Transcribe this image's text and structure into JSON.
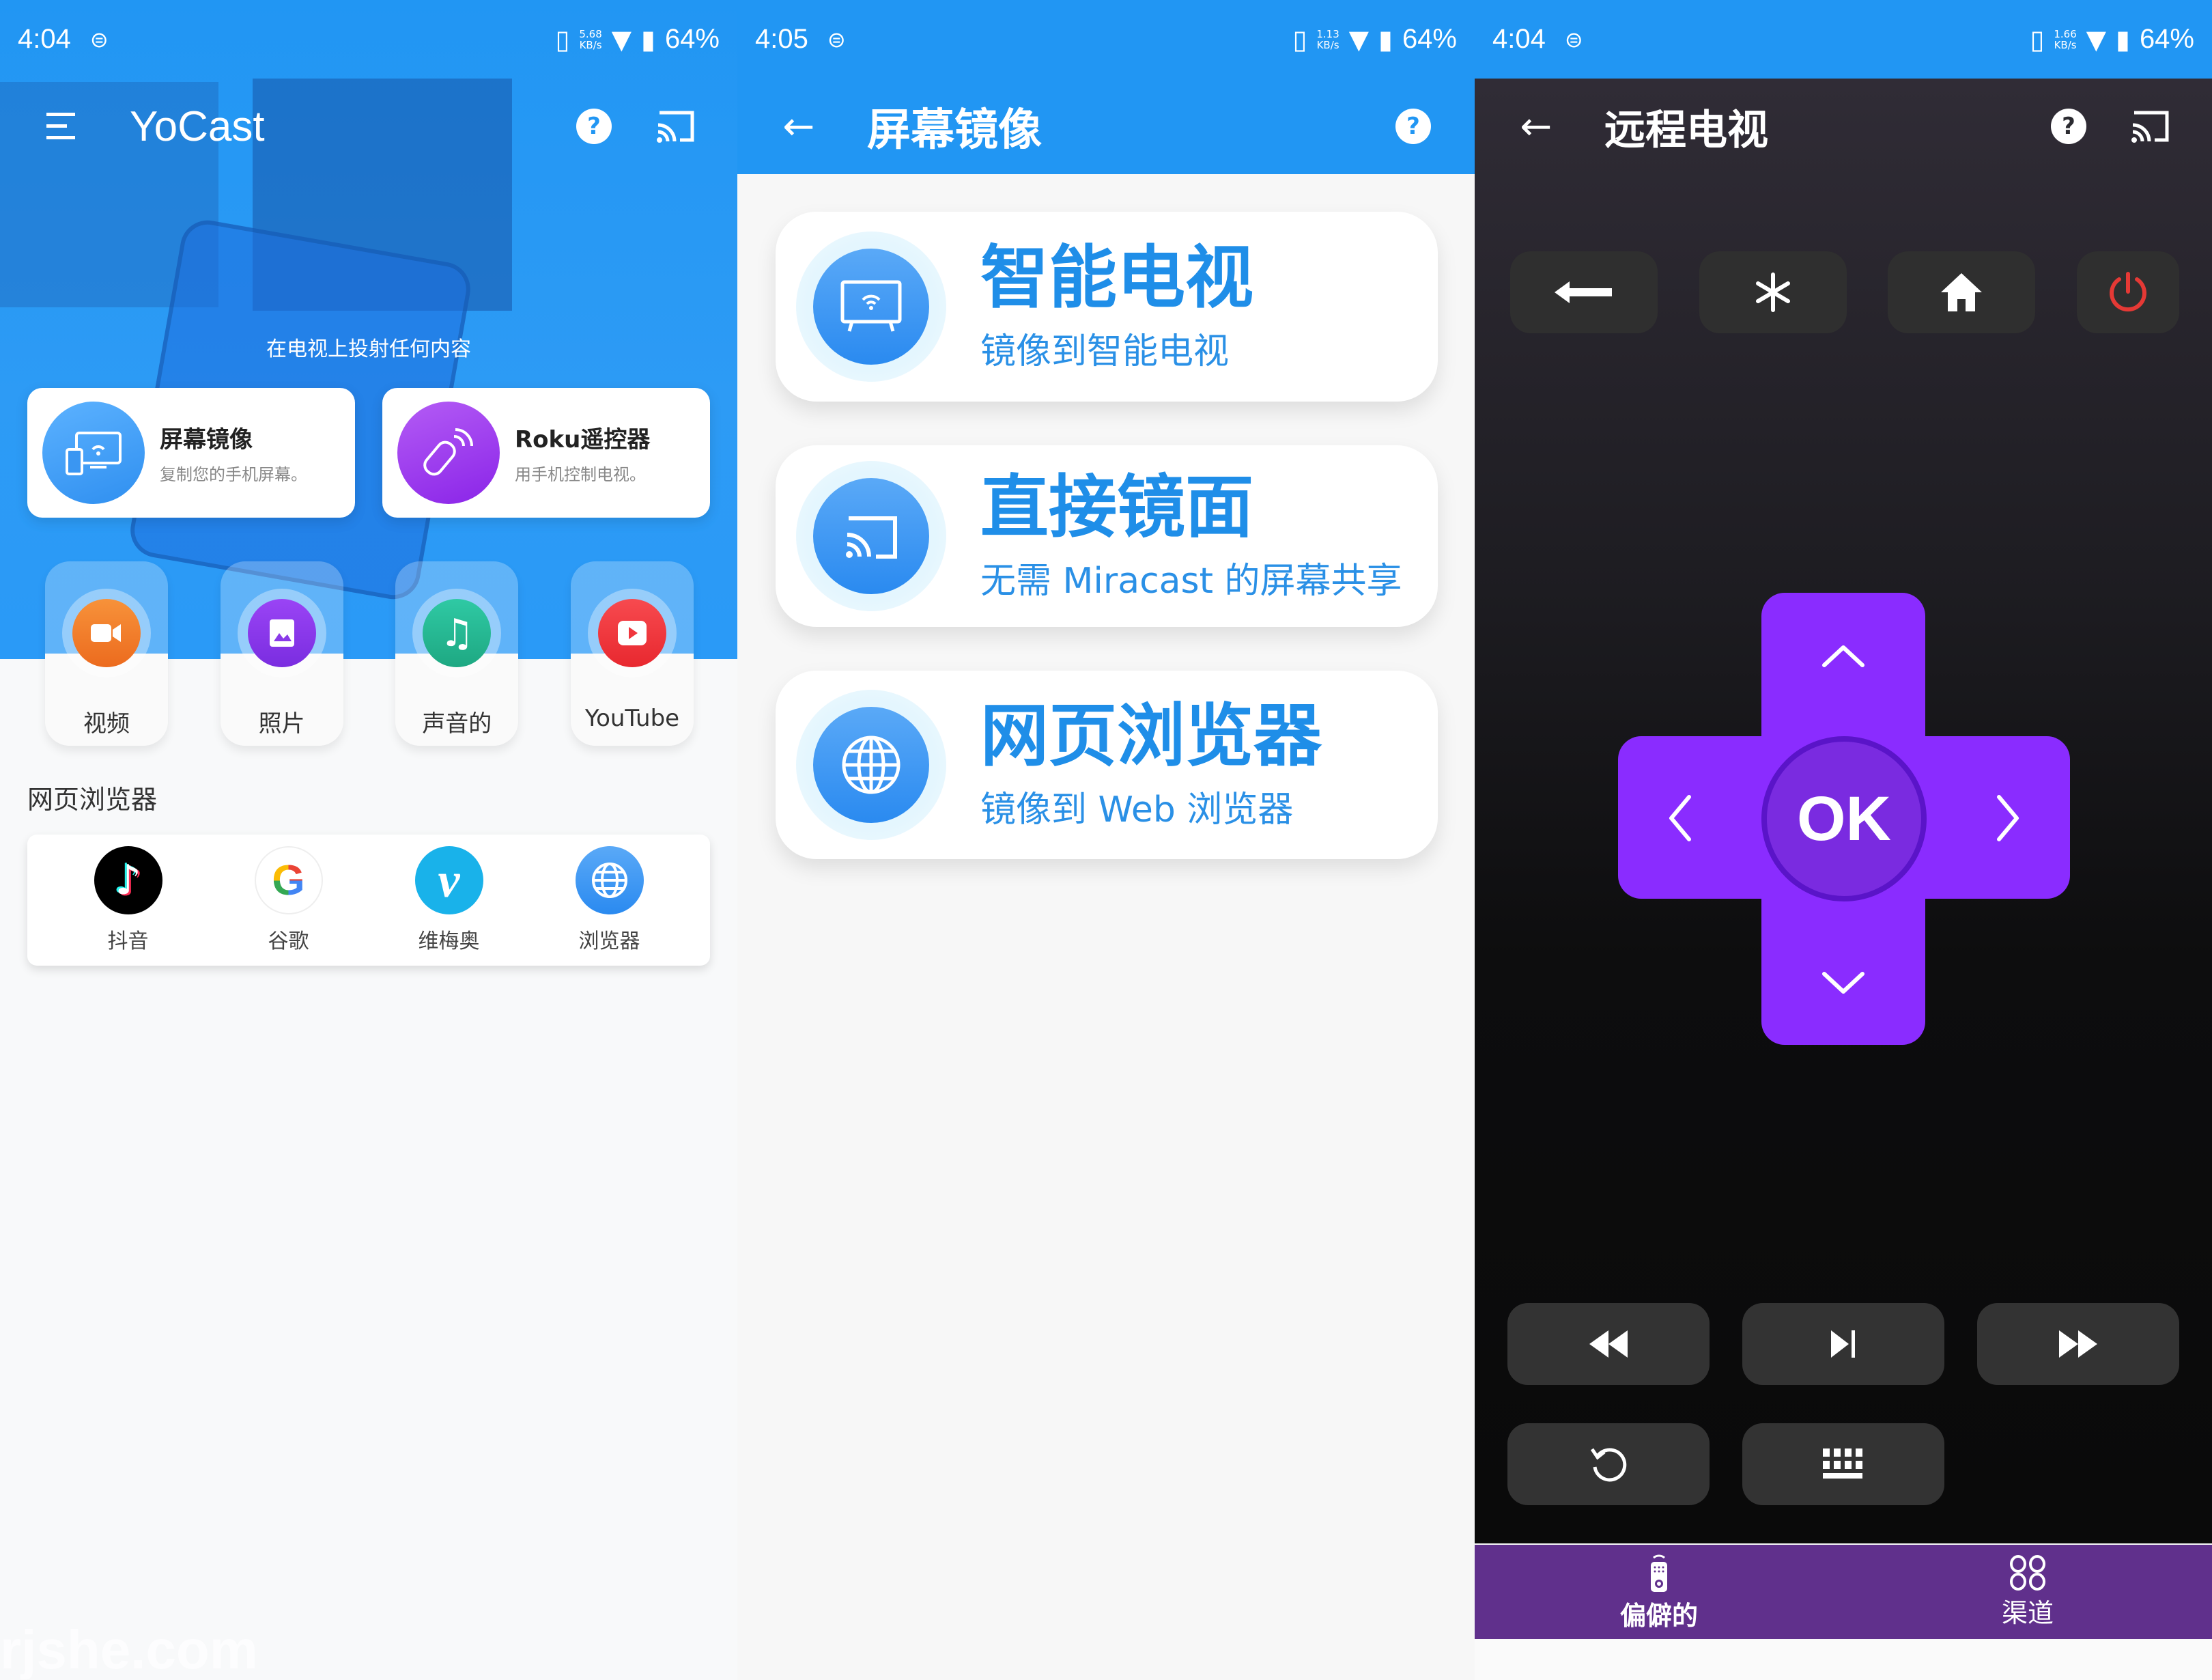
{
  "panels": {
    "home": {
      "status": {
        "time": "4:04",
        "speed_value": "5.68",
        "speed_unit": "KB/s",
        "battery": "64%"
      },
      "appbar": {
        "title": "YoCast",
        "menu_icon": "menu-icon",
        "help_icon": "help-icon",
        "cast_icon": "cast-icon"
      },
      "hero_subtitle": "在电视上投射任何内容",
      "features": [
        {
          "title": "屏幕镜像",
          "subtitle": "复制您的手机屏幕。",
          "icon": "screen-mirror-icon",
          "color": "#3d9cf5"
        },
        {
          "title": "Roku遥控器",
          "subtitle": "用手机控制电视。",
          "icon": "remote-icon",
          "color": "#9b3cf0"
        }
      ],
      "media_tiles": [
        {
          "label": "视频",
          "icon": "video-icon",
          "color": "#f07a2a"
        },
        {
          "label": "照片",
          "icon": "photo-icon",
          "color": "#8a3ae8"
        },
        {
          "label": "声音的",
          "icon": "music-icon",
          "color": "#22b890"
        },
        {
          "label": "YouTube",
          "icon": "youtube-icon",
          "color": "#f0363d"
        }
      ],
      "browser_section_title": "网页浏览器",
      "browsers": [
        {
          "label": "抖音",
          "icon": "tiktok-icon"
        },
        {
          "label": "谷歌",
          "icon": "google-icon"
        },
        {
          "label": "维梅奥",
          "icon": "vimeo-icon"
        },
        {
          "label": "浏览器",
          "icon": "browser-globe-icon"
        }
      ],
      "watermark": "rjshe.com"
    },
    "mirror": {
      "status": {
        "time": "4:05",
        "speed_value": "1.13",
        "speed_unit": "KB/s",
        "battery": "64%"
      },
      "appbar": {
        "title": "屏幕镜像",
        "back_icon": "back-arrow-icon",
        "help_icon": "help-icon"
      },
      "options": [
        {
          "title": "智能电视",
          "subtitle": "镜像到智能电视",
          "icon": "smart-tv-icon"
        },
        {
          "title": "直接镜面",
          "subtitle": "无需 Miracast 的屏幕共享",
          "icon": "cast-icon"
        },
        {
          "title": "网页浏览器",
          "subtitle": "镜像到 Web 浏览器",
          "icon": "globe-icon"
        }
      ]
    },
    "remote": {
      "status": {
        "time": "4:04",
        "speed_value": "1.66",
        "speed_unit": "KB/s",
        "battery": "64%"
      },
      "appbar": {
        "title": "远程电视",
        "back_icon": "back-arrow-icon",
        "help_icon": "help-icon",
        "cast_icon": "cast-icon"
      },
      "top_buttons": [
        {
          "name": "back",
          "glyph": "🡐"
        },
        {
          "name": "options",
          "glyph": "✱"
        },
        {
          "name": "home",
          "glyph": "⌂"
        },
        {
          "name": "power",
          "glyph": "⏻"
        }
      ],
      "dpad": {
        "ok_label": "OK",
        "up": "︿",
        "down": "﹀",
        "left": "〈",
        "right": "〉"
      },
      "media_buttons": [
        {
          "name": "rewind",
          "glyph": "◀◀"
        },
        {
          "name": "play-pause",
          "glyph": "▶|"
        },
        {
          "name": "fast-forward",
          "glyph": "▶▶"
        }
      ],
      "extra_buttons": [
        {
          "name": "replay",
          "glyph": "↺"
        },
        {
          "name": "keyboard",
          "glyph": "⌨"
        }
      ],
      "bottom_nav": [
        {
          "label": "偏僻的",
          "icon": "remote-control-icon",
          "active": true
        },
        {
          "label": "渠道",
          "icon": "channels-grid-icon",
          "active": false
        }
      ],
      "colors": {
        "dpad": "#8a2cff",
        "ok": "#7a2be0",
        "nav": "#60308c",
        "power": "#e53935"
      }
    }
  }
}
